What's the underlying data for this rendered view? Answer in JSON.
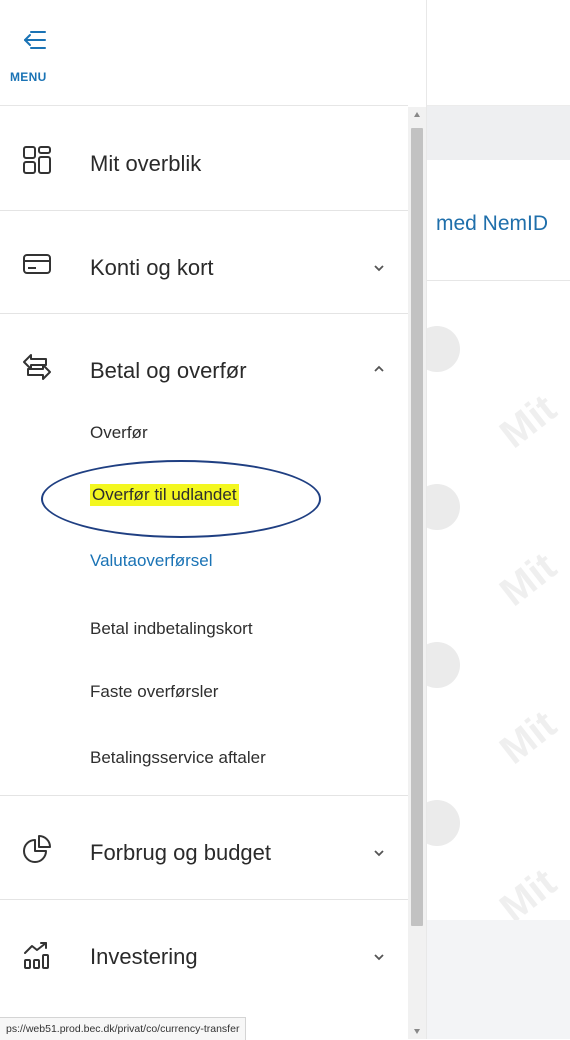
{
  "menu": {
    "label": "MENU",
    "icon": "menu-back-arrow-icon"
  },
  "sidebar": {
    "items": [
      {
        "label": "Mit overblik",
        "icon": "dashboard-grid-icon",
        "expandable": false
      },
      {
        "label": "Konti og kort",
        "icon": "card-icon",
        "expandable": true,
        "expanded": false
      },
      {
        "label": "Betal og overfør",
        "icon": "transfer-arrows-icon",
        "expandable": true,
        "expanded": true,
        "children": [
          {
            "label": "Overfør"
          },
          {
            "label": "Overfør til udlandet",
            "highlighted": true
          },
          {
            "label": "Valutaoverførsel",
            "active": true
          },
          {
            "label": "Betal indbetalingskort"
          },
          {
            "label": "Faste overførsler"
          },
          {
            "label": "Betalingsservice aftaler"
          }
        ]
      },
      {
        "label": "Forbrug og budget",
        "icon": "pie-chart-icon",
        "expandable": true,
        "expanded": false
      },
      {
        "label": "Investering",
        "icon": "investment-chart-icon",
        "expandable": true,
        "expanded": false
      }
    ]
  },
  "content": {
    "nemid_link": "med NemID",
    "placeholder_text": "Mit"
  },
  "status_url": "ps://web51.prod.bec.dk/privat/co/currency-transfer",
  "colors": {
    "accent": "#1a73b5",
    "highlight": "#f3f71f",
    "annotation_ellipse": "#1f3f82"
  }
}
